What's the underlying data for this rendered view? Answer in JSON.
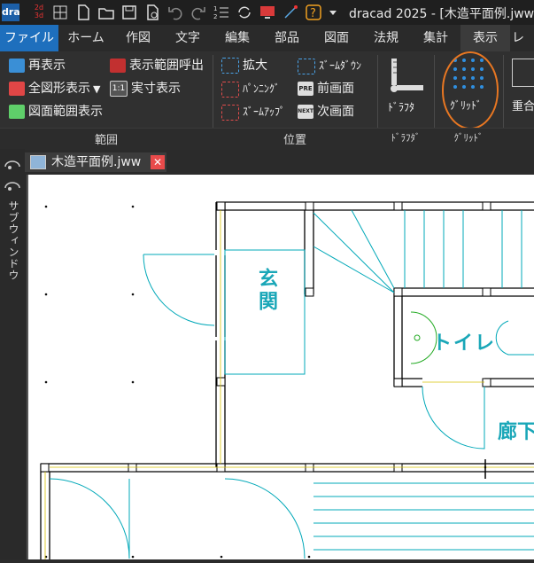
{
  "window": {
    "title": "dracad 2025 - [木造平面例.jww]"
  },
  "quick_access": [
    "app-logo-icon",
    "2d-3d-icon",
    "grid-select-icon",
    "new-file-icon",
    "open-folder-icon",
    "save-icon",
    "print-preview-icon",
    "undo-icon",
    "redo-icon",
    "checklist-icon",
    "refresh-icon",
    "red-screen-icon",
    "measure-icon",
    "help-icon",
    "dropdown-icon"
  ],
  "tabs": [
    "ファイル",
    "ホーム",
    "作図",
    "文字",
    "編集",
    "部品",
    "図面",
    "法規",
    "集計",
    "表示",
    "レ"
  ],
  "ribbon": {
    "range": {
      "redisplay": "再表示",
      "show_all": "全図形表示",
      "drawing_range": "図面範囲表示",
      "call_range": "表示範囲呼出",
      "actual_size": "実寸表示",
      "actual_size_icon": "1:1",
      "group_label": "範囲"
    },
    "position": {
      "zoom_in": "拡大",
      "zoom_down": "ｽﾞｰﾑﾀﾞｳﾝ",
      "panning": "ﾊﾟﾝﾆﾝｸﾞ",
      "prev_screen": "前画面",
      "prev_icon": "PRE",
      "zoom_up": "ｽﾞｰﾑｱｯﾌﾟ",
      "next_screen": "次画面",
      "next_icon": "NEXT",
      "group_label": "位置"
    },
    "drafter": {
      "label": "ﾄﾞﾗﾌﾀ",
      "group_label": "ﾄﾞﾗﾌﾀﾞ"
    },
    "grid": {
      "label": "ｸﾞﾘｯﾄﾞ",
      "group_label": "ｸﾞﾘｯﾄﾞ"
    },
    "overlay": {
      "label": "重合"
    }
  },
  "document": {
    "tab_title": "木造平面例.jww"
  },
  "sidebar": {
    "label": "サブウィンドウ"
  },
  "plan": {
    "room_entrance": "玄関",
    "room_toilet": "トイレ",
    "room_hall": "廊下"
  },
  "colors": {
    "accent": "#1e6fbd",
    "highlight_circle": "#e87722",
    "wall": "#000000",
    "door": "#00a8b8",
    "room_text": "#1aa7b8"
  }
}
